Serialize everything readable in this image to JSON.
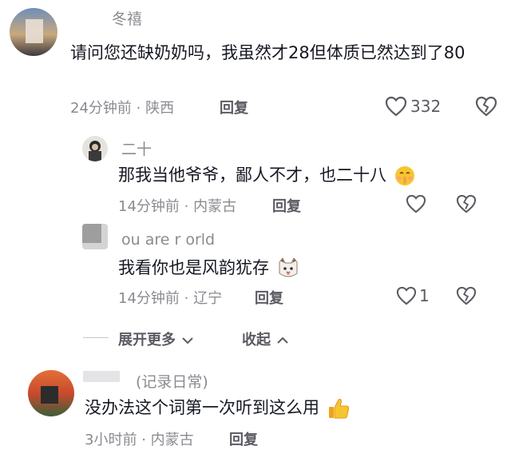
{
  "comments": [
    {
      "username": "冬禧",
      "text": "请问您还缺奶奶吗，我虽然才28但体质已然达到了80",
      "time": "24分钟前",
      "location": "陕西",
      "reply_label": "回复",
      "likes": "332",
      "replies": [
        {
          "username": "二十",
          "text": "那我当他爷爷，鄙人不才，也二十八",
          "time": "14分钟前",
          "location": "内蒙古",
          "reply_label": "回复",
          "likes": ""
        },
        {
          "username": "ou are r  orld",
          "text": "我看你也是风韵犹存",
          "time": "14分钟前",
          "location": "辽宁",
          "reply_label": "回复",
          "likes": "1"
        }
      ],
      "expand_more": "展开更多",
      "collapse": "收起"
    },
    {
      "username": "(记录日常)",
      "text": "没办法这个词第一次听到这么用",
      "time": "3小时前",
      "location": "内蒙古",
      "reply_label": "回复"
    }
  ],
  "meta_separator": "·",
  "icons": {
    "like": "heart-outline-icon",
    "dislike": "broken-heart-icon",
    "expand": "chevron-down-icon",
    "collapse": "chevron-up-icon"
  }
}
